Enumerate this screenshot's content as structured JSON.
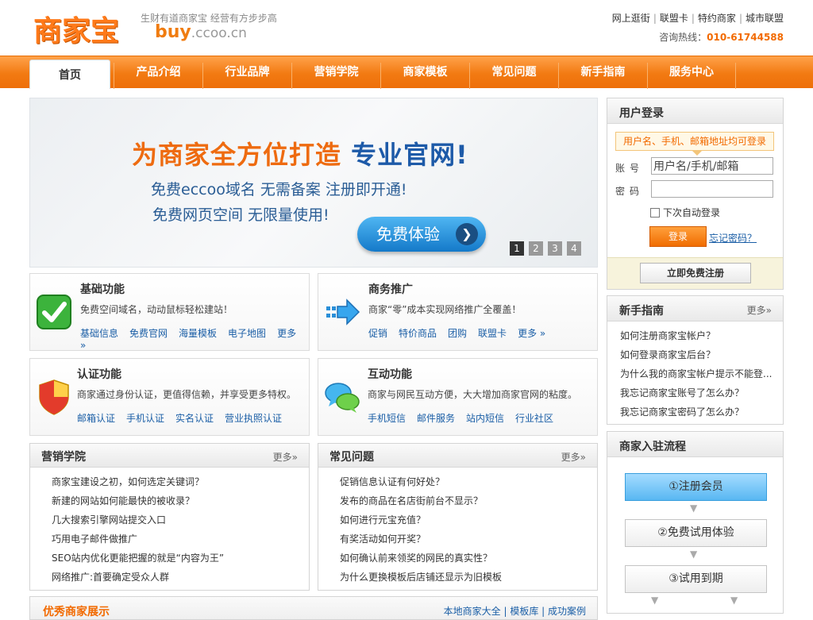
{
  "header": {
    "logo_text": "商家宝",
    "slogan": "生财有道商家宝 经营有方步步高",
    "domain_main": "buy",
    "domain_rest": ".ccoo.cn",
    "top_links": [
      "网上逛街",
      "联盟卡",
      "特约商家",
      "城市联盟"
    ],
    "hotline_label": "咨询热线：",
    "hotline_number": "010-61744588"
  },
  "nav": {
    "items": [
      "首页",
      "产品介绍",
      "行业品牌",
      "营销学院",
      "商家模板",
      "常见问题",
      "新手指南",
      "服务中心"
    ]
  },
  "banner": {
    "headline_a": "为商家全方位打造",
    "headline_b": "专业官网!",
    "line1": "免费eccoo域名  无需备案  注册即开通!",
    "line2": "免费网页空间  无限量使用!",
    "button": "免费体验",
    "pages": [
      "1",
      "2",
      "3",
      "4"
    ]
  },
  "features": [
    {
      "title": "基础功能",
      "desc": "免费空间域名，动动鼠标轻松建站！",
      "links": [
        "基础信息",
        "免费官网",
        "海量模板",
        "电子地图",
        "更多"
      ]
    },
    {
      "title": "商务推广",
      "desc": "商家“零”成本实现网络推广全覆盖！",
      "links": [
        "促销",
        "特价商品",
        "团购",
        "联盟卡",
        "更多"
      ]
    },
    {
      "title": "认证功能",
      "desc": "商家通过身份认证，更值得信赖，并享受更多特权。",
      "links": [
        "邮箱认证",
        "手机认证",
        "实名认证",
        "营业执照认证"
      ]
    },
    {
      "title": "互动功能",
      "desc": "商家与网民互动方便，大大增加商家官网的粘度。",
      "links": [
        "手机短信",
        "邮件服务",
        "站内短信",
        "行业社区"
      ]
    }
  ],
  "marketing": {
    "title": "营销学院",
    "more": "更多»",
    "items": [
      "商家宝建设之初，如何选定关键词？",
      "新建的网站如何能最快的被收录？",
      "几大搜索引擎网站提交入口",
      "巧用电子邮件做推广",
      "SEO站内优化更能把握的就是“内容为王”",
      "网络推广:首要确定受众人群"
    ]
  },
  "faq": {
    "title": "常见问题",
    "more": "更多»",
    "items": [
      "促销信息认证有何好处？",
      "发布的商品在名店街前台不显示？",
      "如何进行元宝充值？",
      "有奖活动如何开奖？",
      "如何确认前来领奖的网民的真实性？",
      "为什么更换模板后店铺还显示为旧模板"
    ]
  },
  "login": {
    "title": "用户登录",
    "tip": "用户名、手机、邮箱地址均可登录",
    "account_label": "账号",
    "password_label": "密码",
    "account_value": "用户名/手机/邮箱",
    "password_value": "",
    "remember": "下次自动登录",
    "login_button": "登录",
    "forgot": "忘记密码？",
    "register_button": "立即免费注册"
  },
  "guide": {
    "title": "新手指南",
    "more": "更多»",
    "items": [
      "如何注册商家宝帐户？",
      "如何登录商家宝后台？",
      "为什么我的商家宝帐户提示不能登...",
      "我忘记商家宝账号了怎么办？",
      "我忘记商家宝密码了怎么办？"
    ]
  },
  "process": {
    "title": "商家入驻流程",
    "steps": [
      "①注册会员",
      "②免费试用体验",
      "③试用到期"
    ]
  },
  "showcase": {
    "title": "优秀商家展示",
    "links": "本地商家大全 | 模板库 | 成功案例"
  }
}
